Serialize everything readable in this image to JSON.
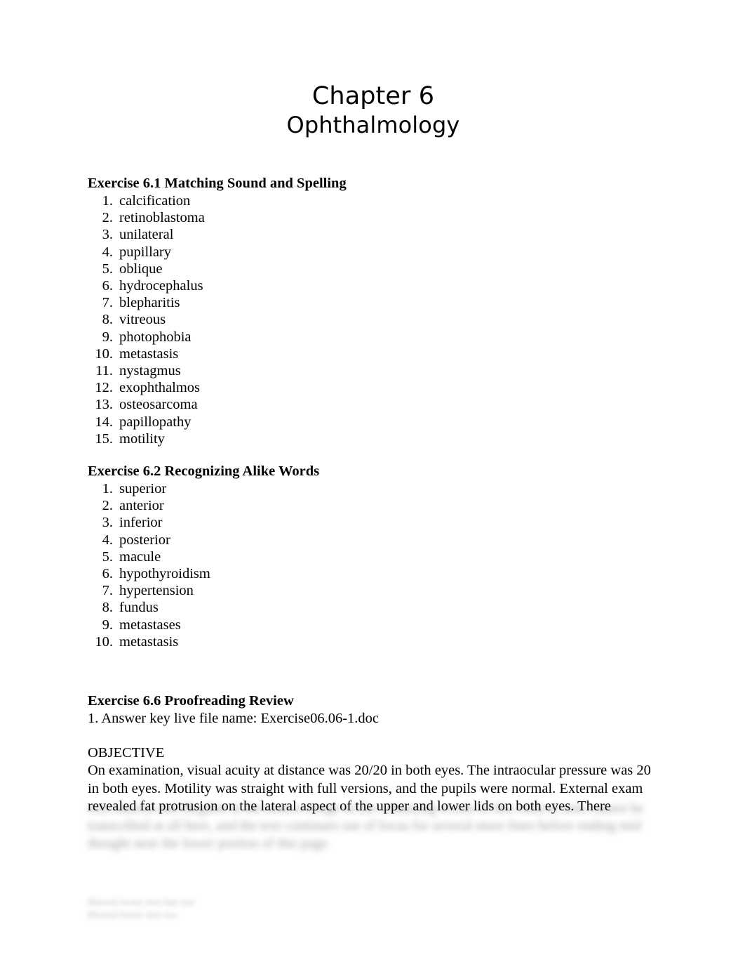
{
  "document": {
    "title_line_1": "Chapter 6",
    "title_line_2": "Ophthalmology"
  },
  "sections": {
    "exercise_61": {
      "heading": "Exercise 6.1 Matching Sound and Spelling",
      "items": [
        {
          "number": "1.",
          "text": "calcification"
        },
        {
          "number": "2.",
          "text": "retinoblastoma"
        },
        {
          "number": "3.",
          "text": "unilateral"
        },
        {
          "number": "4.",
          "text": "pupillary"
        },
        {
          "number": "5.",
          "text": "oblique"
        },
        {
          "number": "6.",
          "text": "hydrocephalus"
        },
        {
          "number": "7.",
          "text": "blepharitis"
        },
        {
          "number": "8.",
          "text": "vitreous"
        },
        {
          "number": "9.",
          "text": "photophobia"
        },
        {
          "number": "10.",
          "text": "metastasis"
        },
        {
          "number": "11.",
          "text": "nystagmus"
        },
        {
          "number": "12.",
          "text": "exophthalmos"
        },
        {
          "number": "13.",
          "text": "osteosarcoma"
        },
        {
          "number": "14.",
          "text": "papillopathy"
        },
        {
          "number": "15.",
          "text": "motility"
        }
      ]
    },
    "exercise_62": {
      "heading": "Exercise 6.2 Recognizing Alike Words",
      "items": [
        {
          "number": "1.",
          "text": "superior"
        },
        {
          "number": "2.",
          "text": "anterior"
        },
        {
          "number": "3.",
          "text": "inferior"
        },
        {
          "number": "4.",
          "text": "posterior"
        },
        {
          "number": "5.",
          "text": "macule"
        },
        {
          "number": "6.",
          "text": "hypothyroidism"
        },
        {
          "number": "7.",
          "text": "hypertension"
        },
        {
          "number": "8.",
          "text": "fundus"
        },
        {
          "number": "9.",
          "text": "metastases"
        },
        {
          "number": "10.",
          "text": "metastasis"
        }
      ]
    },
    "exercise_66": {
      "heading": "Exercise 6.6 Proofreading Review",
      "answer_key_line": "1. Answer key live file name: Exercise06.06-1.doc",
      "objective_heading": "OBJECTIVE",
      "objective_paragraph": "On examination, visual acuity at distance was 20/20 in both eyes. The intraocular pressure was 20 in both eyes. Motility was straight with full versions, and the pupils were normal. External exam revealed fat protrusion on the lateral aspect of the upper and lower lids on both eyes. There"
    }
  },
  "obscured": {
    "paragraph_continuation": "was blurred and illegible in the source image so the remaining words of this clinical note cannot be transcribed at all here, and the text continues out of focus for several more lines before ending mid thought near the lower portion of this page.",
    "footer_block": "Blurred footer text line one\nBlurred footer line two"
  }
}
